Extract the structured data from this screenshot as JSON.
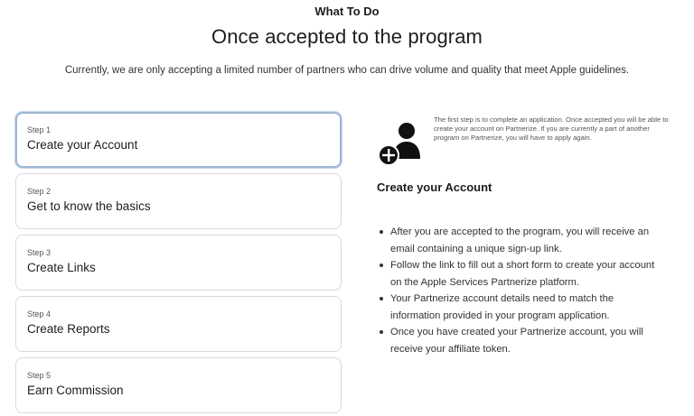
{
  "header": {
    "eyebrow": "What To Do",
    "title": "Once accepted to the program",
    "intro": "Currently, we are only accepting a limited number of partners who can drive volume and quality that meet Apple guidelines."
  },
  "steps": [
    {
      "number": "Step 1",
      "title": "Create your Account",
      "active": true
    },
    {
      "number": "Step 2",
      "title": "Get to know the basics",
      "active": false
    },
    {
      "number": "Step 3",
      "title": "Create Links",
      "active": false
    },
    {
      "number": "Step 4",
      "title": "Create Reports",
      "active": false
    },
    {
      "number": "Step 5",
      "title": "Earn Commission",
      "active": false
    }
  ],
  "detail": {
    "icon": "add-person-icon",
    "blurb": "The first step is to complete an application. Once accepted you will be able to create your account on Partnerize. If you are currently a part of another program on Partnerize, you will have to apply again.",
    "title": "Create your Account",
    "bullets": [
      "After you are accepted to the program, you will receive an email containing a unique sign-up link.",
      "Follow the link to fill out a short form to create your account on the Apple Services Partnerize platform.",
      "Your Partnerize account details need to match the information provided in your program application.",
      "Once you have created your Partnerize account, you will receive your affiliate token."
    ]
  },
  "colors": {
    "text": "#1d1d1f",
    "active_border": "#9fb7d6",
    "card_border": "#d9d9de"
  }
}
